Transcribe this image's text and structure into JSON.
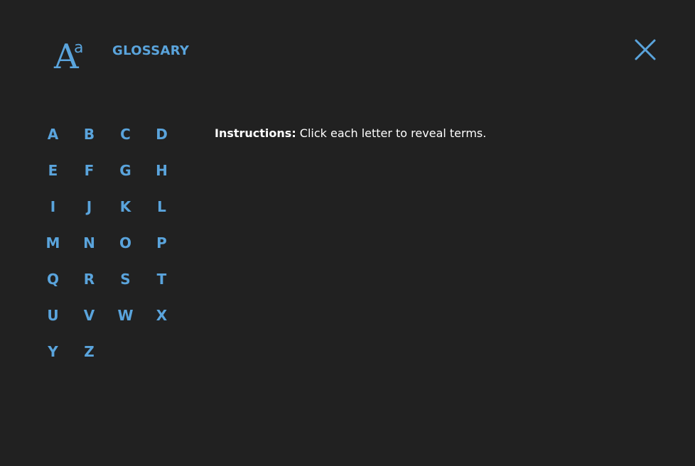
{
  "header": {
    "icon": "font-aa-icon",
    "icon_text_big": "A",
    "icon_text_small": "a",
    "title": "GLOSSARY",
    "close_icon": "close-icon"
  },
  "letters": [
    "A",
    "B",
    "C",
    "D",
    "E",
    "F",
    "G",
    "H",
    "I",
    "J",
    "K",
    "L",
    "M",
    "N",
    "O",
    "P",
    "Q",
    "R",
    "S",
    "T",
    "U",
    "V",
    "W",
    "X",
    "Y",
    "Z"
  ],
  "instructions": {
    "label": "Instructions:",
    "text": " Click each letter to reveal terms."
  },
  "colors": {
    "background": "#212121",
    "accent": "#5aa4dc",
    "text": "#ffffff"
  }
}
